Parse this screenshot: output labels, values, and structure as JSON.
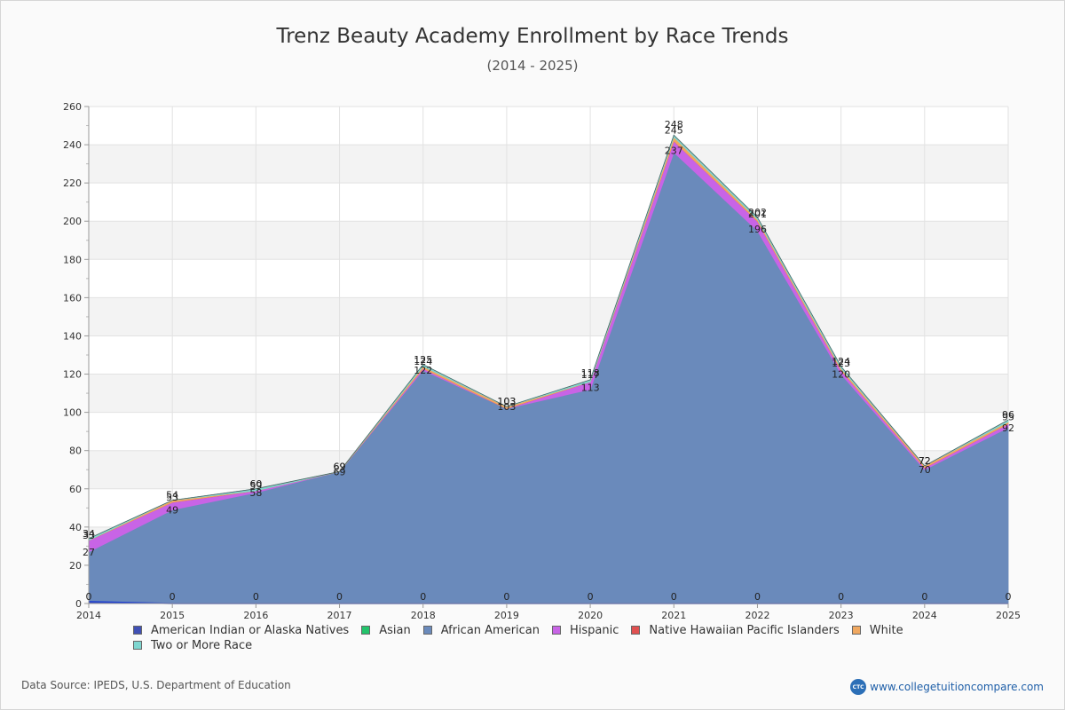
{
  "page": {
    "source_text": "Data Source: IPEDS, U.S. Department of Education",
    "brand_text": "www.collegetuitioncompare.com",
    "brand_badge": "CTC"
  },
  "chart_data": {
    "type": "area",
    "stacked": true,
    "title": "Trenz Beauty Academy Enrollment by Race Trends",
    "subtitle": "(2014 - 2025)",
    "xlabel": "",
    "ylabel": "",
    "x": [
      "2014",
      "2015",
      "2016",
      "2017",
      "2018",
      "2019",
      "2020",
      "2021",
      "2022",
      "2023",
      "2024",
      "2025"
    ],
    "ylim": [
      0,
      260
    ],
    "yticks": [
      0,
      20,
      40,
      60,
      80,
      100,
      120,
      140,
      160,
      180,
      200,
      220,
      240,
      260
    ],
    "grid": true,
    "legend_position": "bottom",
    "series": [
      {
        "name": "American Indian or Alaska Natives",
        "color": "#4050b5",
        "values": [
          1,
          0,
          0,
          0,
          0,
          0,
          0,
          0,
          0,
          0,
          0,
          0
        ]
      },
      {
        "name": "Asian",
        "color": "#23c36b",
        "values": [
          0,
          0,
          0,
          0,
          0,
          0,
          0,
          0,
          0,
          0,
          0,
          0
        ]
      },
      {
        "name": "African American",
        "color": "#6a8abb",
        "values": [
          26,
          49,
          58,
          69,
          122,
          102,
          112,
          236,
          195,
          120,
          70,
          92
        ]
      },
      {
        "name": "Hispanic",
        "color": "#c864e6",
        "values": [
          6,
          4,
          1,
          0,
          1,
          0,
          4,
          6,
          5,
          2,
          1,
          2
        ]
      },
      {
        "name": "Native Hawaiian Pacific Islanders",
        "color": "#e05050",
        "values": [
          0,
          0,
          0,
          0,
          0,
          0,
          0,
          0,
          0,
          0,
          0,
          0
        ]
      },
      {
        "name": "White",
        "color": "#f0a860",
        "values": [
          0,
          1,
          0,
          0,
          1,
          1,
          0,
          2,
          1,
          1,
          1,
          1
        ]
      },
      {
        "name": "Two or More Race",
        "color": "#7ed6d0",
        "values": [
          1,
          0,
          1,
          0,
          1,
          0,
          1,
          1,
          1,
          1,
          0,
          1
        ]
      }
    ],
    "point_labels": {
      "bottom": [
        "0",
        "0",
        "0",
        "0",
        "0",
        "0",
        "0",
        "0",
        "0",
        "0",
        "0",
        "0"
      ],
      "lower": [
        "27",
        "49",
        "58",
        "69",
        "122",
        "103",
        "113",
        "237",
        "196",
        "120",
        "70",
        "92"
      ],
      "middle": [
        "33",
        "53",
        "59",
        "69",
        "124",
        "103",
        "117",
        "245",
        "201",
        "123",
        "72",
        "95"
      ],
      "top": [
        "34",
        "54",
        "60",
        "69",
        "125",
        "103",
        "118",
        "248",
        "202",
        "124",
        "72",
        "96"
      ]
    }
  }
}
